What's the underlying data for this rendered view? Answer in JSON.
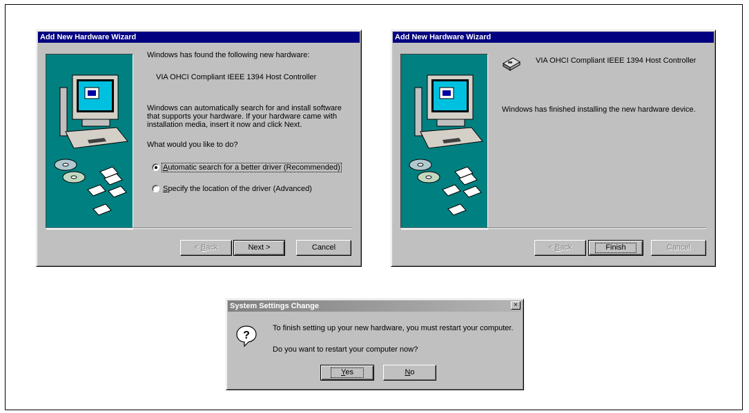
{
  "wizard1": {
    "title": "Add New Hardware Wizard",
    "found_text": "Windows has found the following new hardware:",
    "device_name": "VIA OHCI Compliant IEEE 1394 Host Controller",
    "search_text_1": "Windows can automatically search for and install software",
    "search_text_2": "that supports your hardware. If your hardware came with",
    "search_text_3": "installation media, insert it now and click Next.",
    "question": "What would you like to do?",
    "option_auto_mnemonic": "A",
    "option_auto_rest": "utomatic search for a better driver (Recommended)",
    "option_specify_mnemonic": "S",
    "option_specify_rest": "pecify the location of the driver (Advanced)",
    "selected_option": "automatic",
    "back_prefix": "< ",
    "back_mnemonic": "B",
    "back_rest": "ack",
    "next_label": "Next >",
    "cancel_label": "Cancel"
  },
  "wizard2": {
    "title": "Add New Hardware Wizard",
    "device_name": "VIA OHCI Compliant IEEE 1394 Host Controller",
    "finished_text": "Windows has finished installing the new hardware device.",
    "back_prefix": "< ",
    "back_mnemonic": "B",
    "back_rest": "ack",
    "finish_label": "Finish",
    "cancel_label": "Cancel"
  },
  "settings_dialog": {
    "title": "System Settings Change",
    "close_glyph": "×",
    "message": "To finish setting up your new hardware, you must restart your computer.",
    "question": "Do you want to restart your computer now?",
    "yes_mnemonic": "Y",
    "yes_rest": "es",
    "no_mnemonic": "N",
    "no_rest": "o",
    "icon_glyph": "?"
  },
  "colors": {
    "title_active": "#000080",
    "panel_teal": "#008080",
    "dialog_gray": "#c0c0c0"
  }
}
